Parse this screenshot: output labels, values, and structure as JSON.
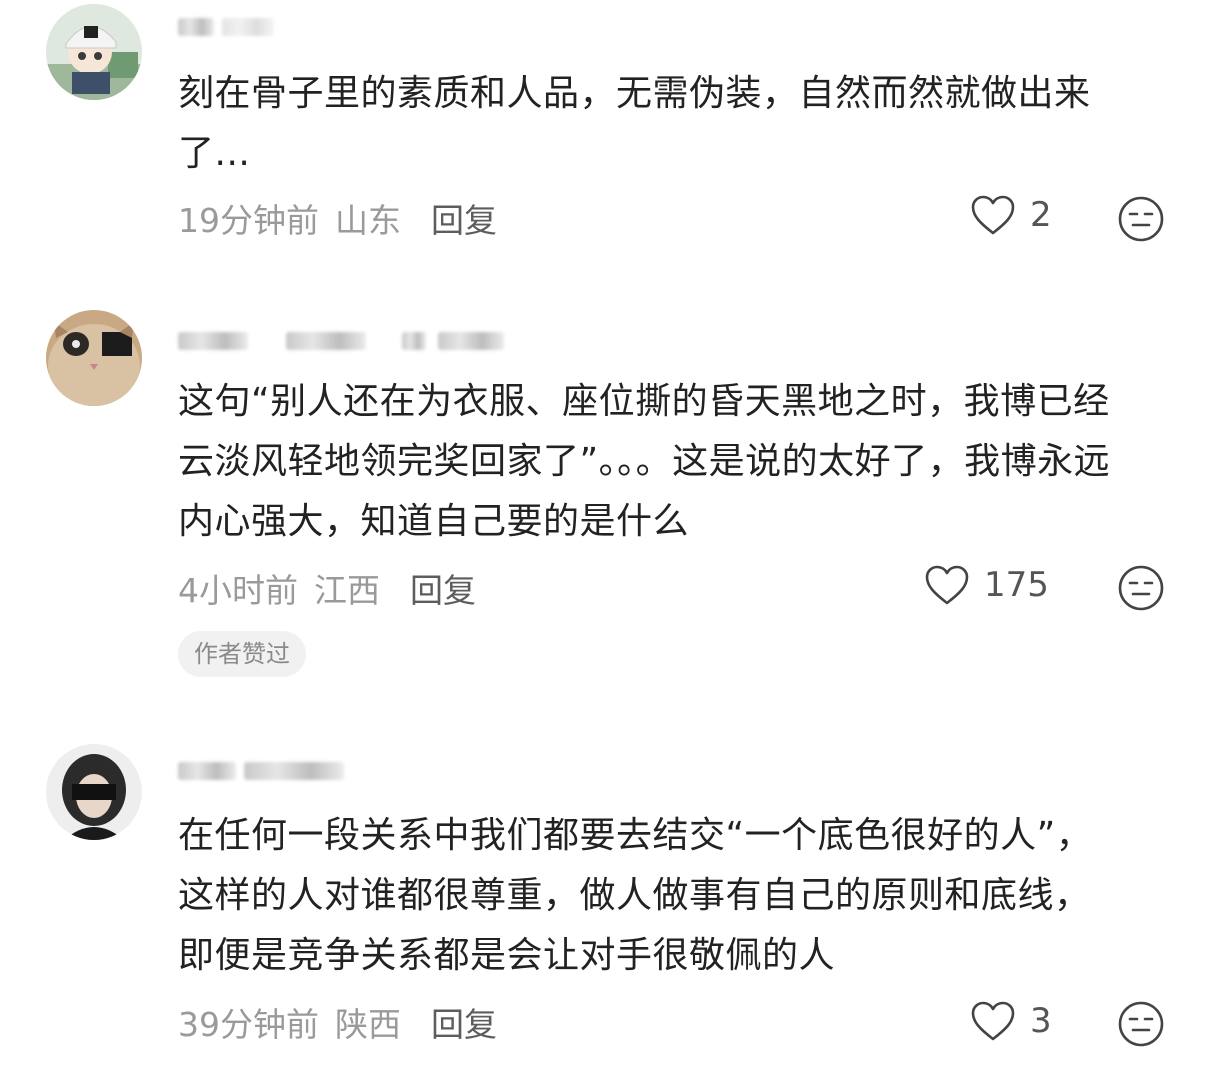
{
  "comments": [
    {
      "text_lines": [
        "刻在骨子里的素质和人品，无需伪装，自然而然就做出来",
        "了..."
      ],
      "time": "19分钟前",
      "location": "山东",
      "reply_label": "回复",
      "likes": "2"
    },
    {
      "text_lines": [
        "这句“别人还在为衣服、座位撕的昏天黑地之时，我博已经",
        "云淡风轻地领完奖回家了”。。。这是说的太好了，我博永远",
        "内心强大，知道自己要的是什么"
      ],
      "time": "4小时前",
      "location": "江西",
      "reply_label": "回复",
      "likes": "175",
      "badge": "作者赞过"
    },
    {
      "text_lines": [
        "在任何一段关系中我们都要去结交“一个底色很好的人”，",
        "这样的人对谁都很尊重，做人做事有自己的原则和底线，",
        "即便是竞争关系都是会让对手很敬佩的人"
      ],
      "time": "39分钟前",
      "location": "陕西",
      "reply_label": "回复",
      "likes": "3"
    }
  ],
  "icons": {
    "like": "heart-outline-icon",
    "emoji": "expressionless-face-icon"
  },
  "colors": {
    "text": "#222222",
    "meta": "#9a9a9a",
    "reply": "#5d5d5d",
    "badge_bg": "#f1f1f1"
  }
}
